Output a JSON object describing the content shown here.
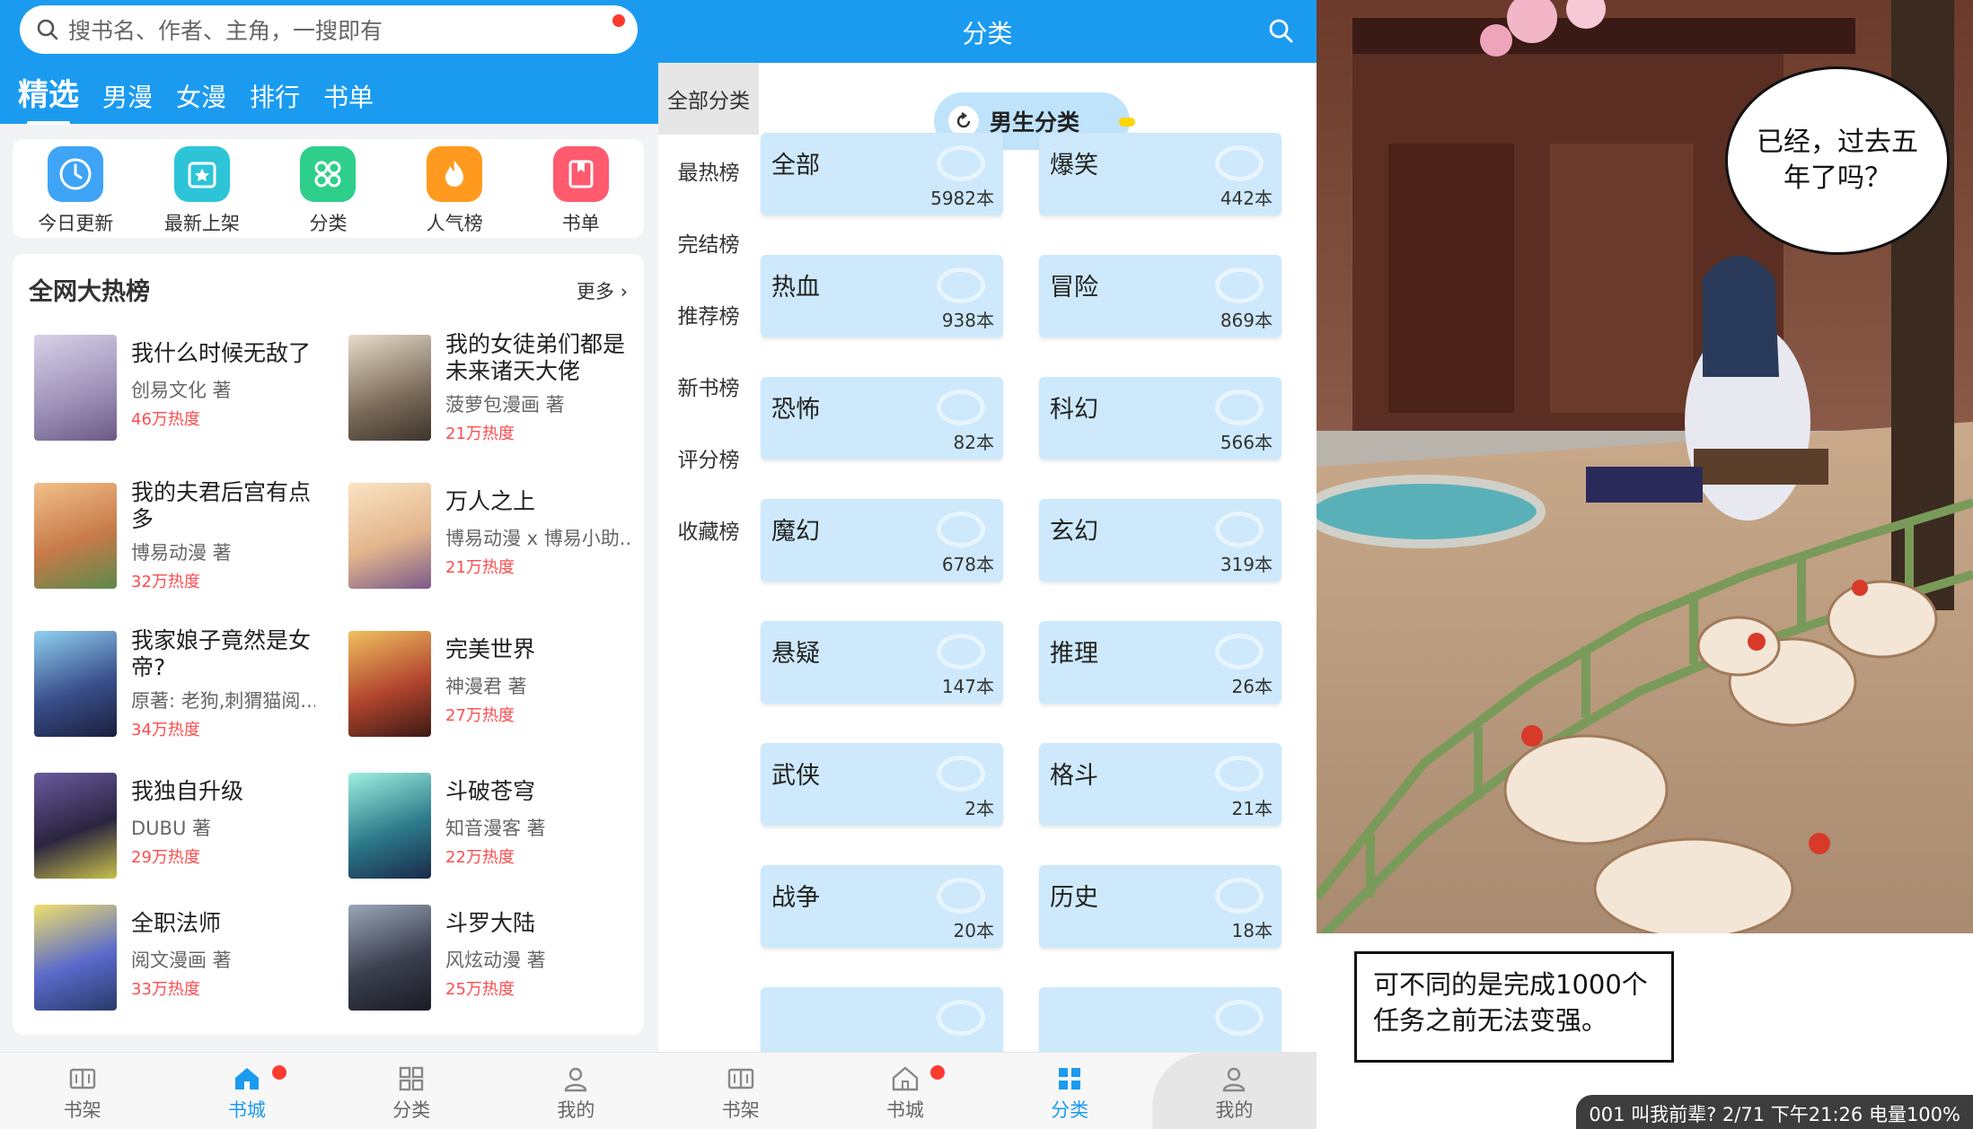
{
  "panel1": {
    "search_placeholder": "搜书名、作者、主角，一搜即有",
    "top_tabs": [
      "精选",
      "男漫",
      "女漫",
      "排行",
      "书单"
    ],
    "quick": [
      {
        "label": "今日更新",
        "icon": "clock-icon",
        "color": "#3fa4f6"
      },
      {
        "label": "最新上架",
        "icon": "star-box-icon",
        "color": "#2ec4d8"
      },
      {
        "label": "分类",
        "icon": "grid-icon",
        "color": "#2ecf8a"
      },
      {
        "label": "人气榜",
        "icon": "fire-icon",
        "color": "#ff9a1f"
      },
      {
        "label": "书单",
        "icon": "bookmark-icon",
        "color": "#ff5a6e"
      }
    ],
    "hot_title": "全网大热榜",
    "hot_more": "更多",
    "books": [
      {
        "title": "我什么时候无敌了",
        "author": "创易文化 著",
        "heat": "46万热度",
        "cover": "#9b8fb6"
      },
      {
        "title": "我的女徒弟们都是未来诸天大佬",
        "author": "菠萝包漫画 著",
        "heat": "21万热度",
        "cover": "#7a6a5a"
      },
      {
        "title": "我的夫君后宫有点多",
        "author": "博易动漫 著",
        "heat": "32万热度",
        "cover": "#c77a4a"
      },
      {
        "title": "万人之上",
        "author": "博易动漫 x 博易小助...",
        "heat": "21万热度",
        "cover": "#e2b58c"
      },
      {
        "title": "我家娘子竟然是女帝?",
        "author": "原著: 老狗,刺猬猫阅...",
        "heat": "34万热度",
        "cover": "#3a4f8c"
      },
      {
        "title": "完美世界",
        "author": "神漫君 著",
        "heat": "27万热度",
        "cover": "#b2452e"
      },
      {
        "title": "我独自升级",
        "author": "DUBU 著",
        "heat": "29万热度",
        "cover": "#2a2540"
      },
      {
        "title": "斗破苍穹",
        "author": "知音漫客 著",
        "heat": "22万热度",
        "cover": "#2c7a8a"
      },
      {
        "title": "全职法师",
        "author": "阅文漫画 著",
        "heat": "33万热度",
        "cover": "#5a6acb"
      },
      {
        "title": "斗罗大陆",
        "author": "风炫动漫 著",
        "heat": "25万热度",
        "cover": "#3b3f4e"
      }
    ],
    "tabbar": [
      "书架",
      "书城",
      "分类",
      "我的"
    ]
  },
  "panel2": {
    "title": "分类",
    "side": [
      "全部分类",
      "最热榜",
      "完结榜",
      "推荐榜",
      "新书榜",
      "评分榜",
      "收藏榜"
    ],
    "pill": "男生分类",
    "categories": [
      {
        "name": "全部",
        "count": "5982本"
      },
      {
        "name": "爆笑",
        "count": "442本"
      },
      {
        "name": "热血",
        "count": "938本"
      },
      {
        "name": "冒险",
        "count": "869本"
      },
      {
        "name": "恐怖",
        "count": "82本"
      },
      {
        "name": "科幻",
        "count": "566本"
      },
      {
        "name": "魔幻",
        "count": "678本"
      },
      {
        "name": "玄幻",
        "count": "319本"
      },
      {
        "name": "悬疑",
        "count": "147本"
      },
      {
        "name": "推理",
        "count": "26本"
      },
      {
        "name": "武侠",
        "count": "2本"
      },
      {
        "name": "格斗",
        "count": "21本"
      },
      {
        "name": "战争",
        "count": "20本"
      },
      {
        "name": "历史",
        "count": "18本"
      }
    ],
    "tabbar": [
      "书架",
      "书城",
      "分类",
      "我的"
    ]
  },
  "panel3": {
    "bubble": "已经，过去五年了吗？",
    "caption": "可不同的是完成1000个任务之前无法变强。",
    "status": "001 叫我前辈? 2/71 下午21:26 电量100%"
  },
  "colors": {
    "primary": "#1b9bf0",
    "heat": "#ff4d4f",
    "category_bg": "#cde9fb"
  }
}
